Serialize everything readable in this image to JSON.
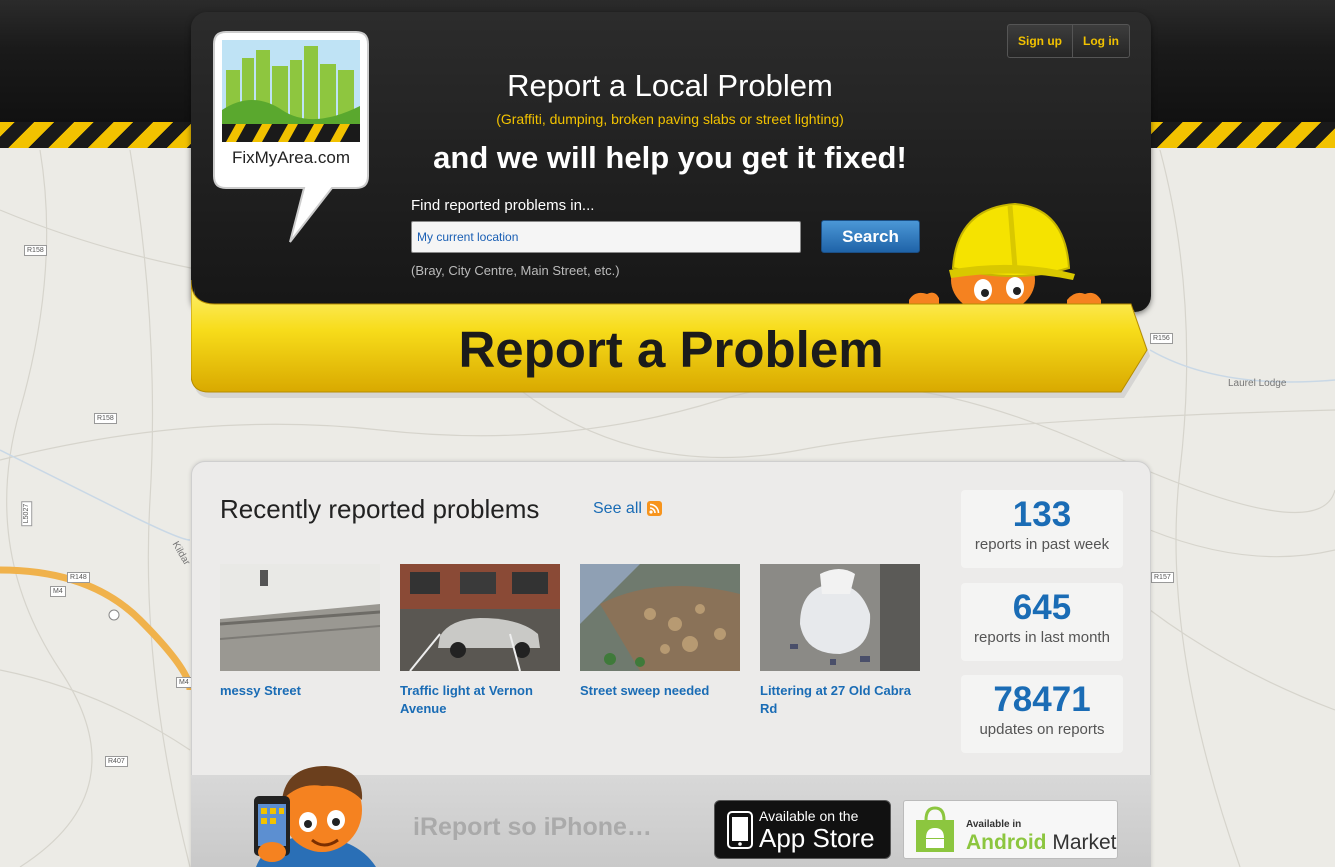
{
  "colors": {
    "brand_yellow": "#f2c200",
    "link_blue": "#1a6cb5",
    "dark": "#161616"
  },
  "map": {
    "road_labels": [
      "R158",
      "R158",
      "R148",
      "M4",
      "M4",
      "R407",
      "R156",
      "R157",
      "L5027"
    ],
    "place_labels": [
      "Laurel Lodge",
      "Kildar"
    ]
  },
  "logo": {
    "text": "FixMyArea.com",
    "icon": "city-skyline-speech-bubble-icon"
  },
  "auth": {
    "signup_label": "Sign up",
    "login_label": "Log in"
  },
  "hero": {
    "title": "Report a Local Problem",
    "subtitle": "(Graffiti, dumping, broken paving slabs or street lighting)",
    "tagline": "and we will help you get it fixed!"
  },
  "search": {
    "label": "Find reported problems in...",
    "value": "My current location",
    "button_label": "Search",
    "hint": "(Bray, City Centre, Main Street, etc.)"
  },
  "report_banner": {
    "label": "Report a Problem"
  },
  "recent": {
    "heading": "Recently reported problems",
    "see_all_label": "See all",
    "rss_icon": "rss-icon",
    "items": [
      {
        "title": "messy Street",
        "thumb": "street-wall-photo"
      },
      {
        "title": "Traffic light at Vernon Avenue",
        "thumb": "car-parking-photo"
      },
      {
        "title": "Street sweep needed",
        "thumb": "leaves-litter-photo"
      },
      {
        "title": "Littering at 27 Old Cabra Rd",
        "thumb": "rubbish-bag-photo"
      }
    ]
  },
  "stats": [
    {
      "value": "133",
      "label": "reports in past week"
    },
    {
      "value": "645",
      "label": "reports in last month"
    },
    {
      "value": "78471",
      "label": "updates on reports"
    }
  ],
  "app_band": {
    "text": "iReport so iPhone…",
    "appstore_small": "Available on the",
    "appstore_big": "App Store",
    "android_small": "Available in",
    "android_big_1": "Android",
    "android_big_2": "Market"
  }
}
